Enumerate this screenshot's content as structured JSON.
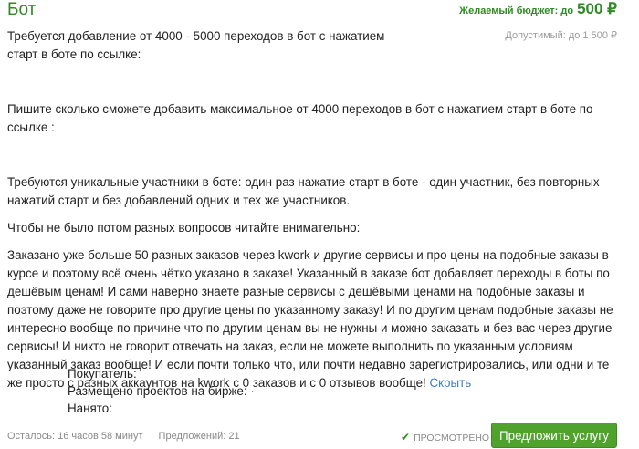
{
  "title": "Бот",
  "budget": {
    "label": "Желаемый бюджет: до",
    "amount": "500 ₽",
    "allowed": "Допустимый: до 1 500 ₽"
  },
  "description": {
    "p1": "Требуется добавление от 4000 - 5000 переходов в бот с нажатием старт в боте по ссылке:",
    "p2": "Пишите сколько сможете добавить максимальное от 4000 переходов в бот с нажатием старт в боте по ссылке :",
    "p3": "Требуются уникальные участники в боте: один раз нажатие старт в боте - один участник, без повторных нажатий старт и без добавлений одних и тех же участников.",
    "p4": "Чтобы не было потом разных вопросов читайте внимательно:",
    "p5": "Заказано уже больше 50 разных заказов через kwork и другие сервисы и про цены на подобные заказы в курсе и поэтому всё очень чётко указано в заказе! Указанный в заказе бот добавляет переходы в боты по дешёвым ценам! И сами наверно знаете разные сервисы с дешёвыми ценами на подобные заказы и поэтому даже не говорите про другие цены по указанному заказу! И по другим ценам подобные заказы не интересно вообще по причине что по другим ценам вы не нужны и можно заказать и без вас через другие сервисы! И никто не говорит отвечать на заказ, если не можете выполнить по указанным условиям указанный заказ вообще! И если почти только что, или почти недавно зарегистрировались, или одни и те же просто с разных аккаунтов на kwork с 0 заказов и с 0 отзывов вообще!",
    "hide_link": "Скрыть"
  },
  "buyer": {
    "buyer_label": "Покупатель:",
    "projects_label": "Размещено проектов на бирже:",
    "projects_value": "·",
    "hired_label": "Нанято:"
  },
  "footer": {
    "remaining": "Осталось: 16 часов 58 минут",
    "proposals": "Предложений: 21",
    "viewed": "ПРОСМОТРЕНО",
    "offer_button": "Предложить услугу"
  },
  "colors": {
    "accent_green": "#2e8b24",
    "button_green": "#4fa32c",
    "link_blue": "#3d7ec5"
  }
}
